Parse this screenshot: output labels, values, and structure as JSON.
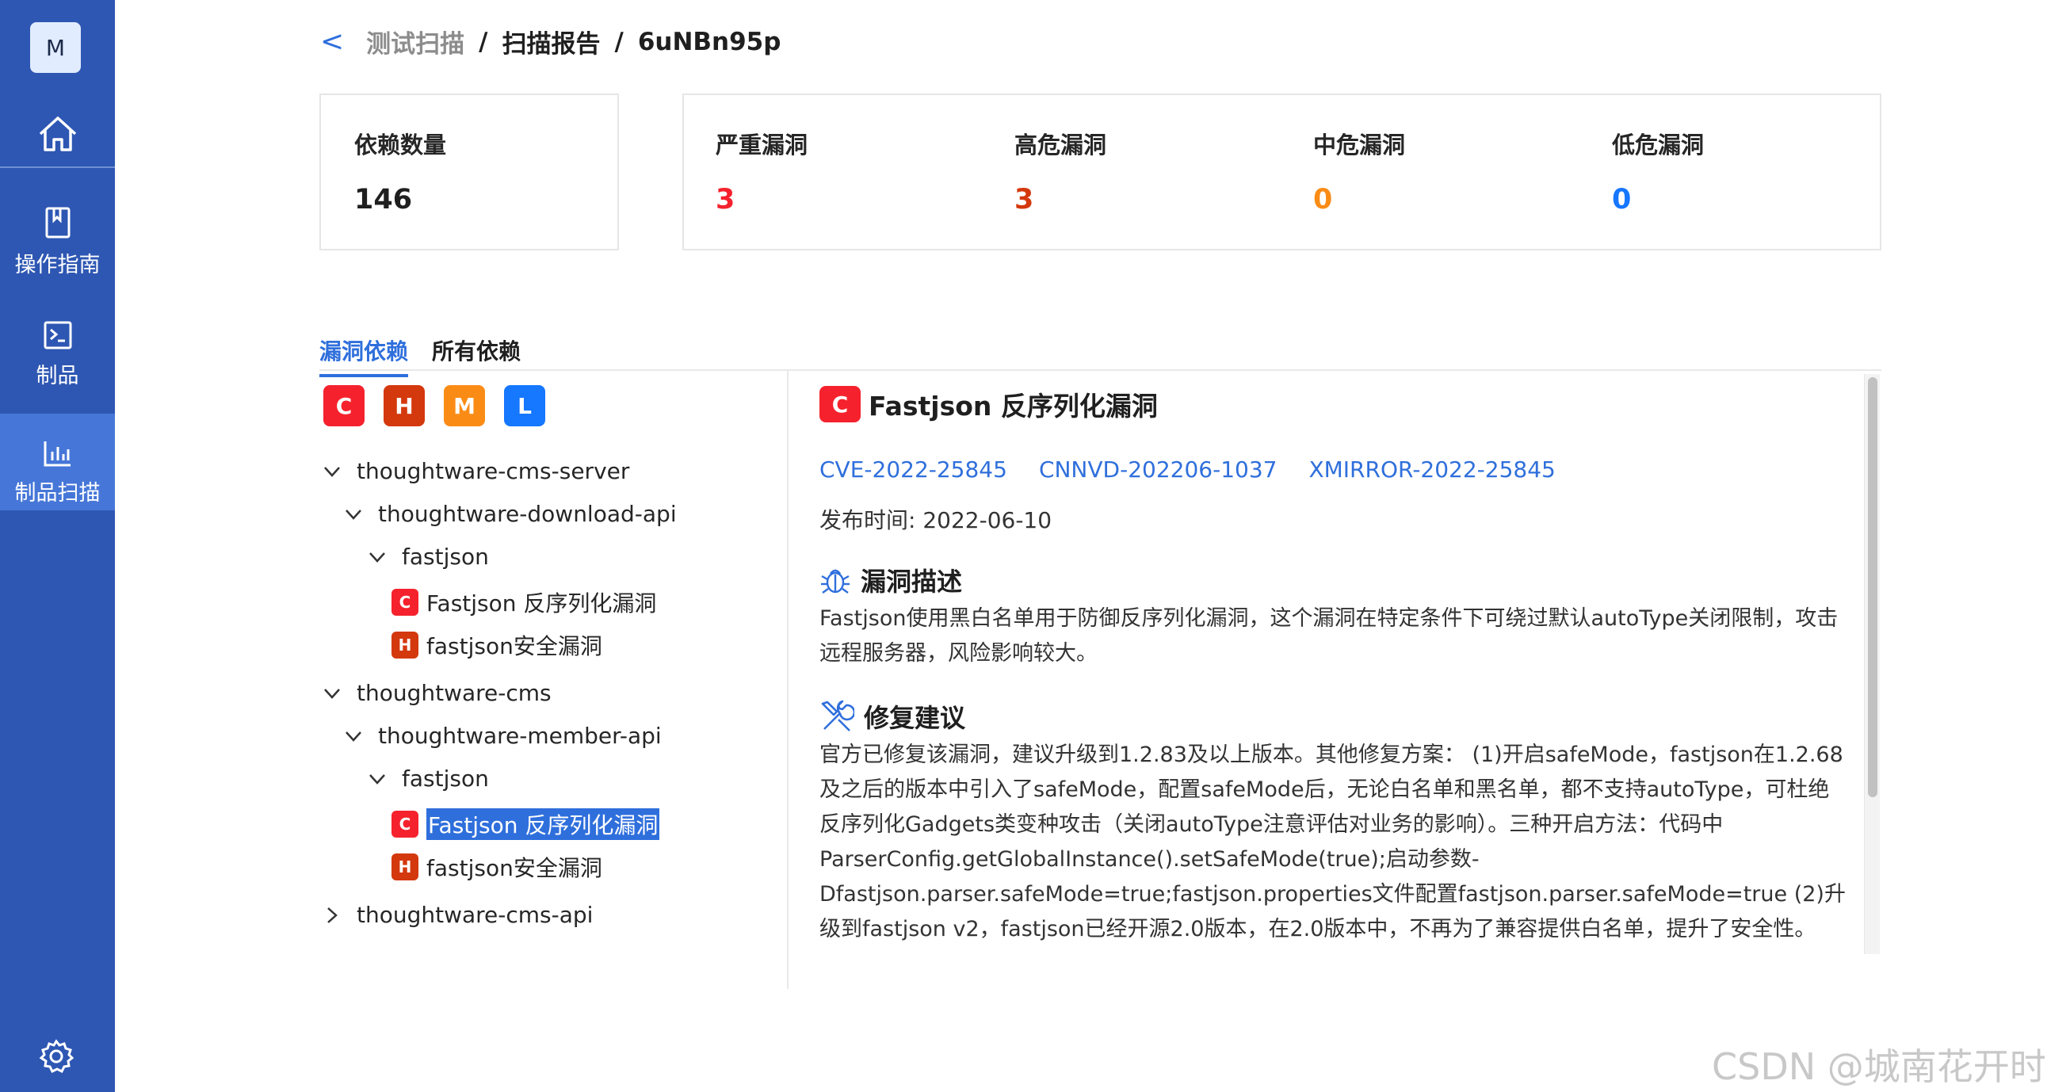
{
  "sidebar": {
    "avatar_letter": "M",
    "items": [
      {
        "label": "操作指南",
        "icon": "book-icon"
      },
      {
        "label": "制品",
        "icon": "terminal-icon"
      },
      {
        "label": "制品扫描",
        "icon": "chart-icon",
        "active": true
      }
    ]
  },
  "breadcrumb": {
    "back_label": "<",
    "parts": [
      "测试扫描",
      "/",
      "扫描报告",
      "/",
      "6uNBn95p"
    ]
  },
  "stats": {
    "dependencies": {
      "label": "依赖数量",
      "value": "146"
    },
    "critical": {
      "label": "严重漏洞",
      "value": "3",
      "color": "#f5222d"
    },
    "high": {
      "label": "高危漏洞",
      "value": "3",
      "color": "#d4380d"
    },
    "medium": {
      "label": "中危漏洞",
      "value": "0",
      "color": "#fa8c16"
    },
    "low": {
      "label": "低危漏洞",
      "value": "0",
      "color": "#1677ff"
    }
  },
  "tabs": [
    {
      "label": "漏洞依赖",
      "active": true
    },
    {
      "label": "所有依赖",
      "active": false
    }
  ],
  "severity_filters": [
    "C",
    "H",
    "M",
    "L"
  ],
  "severity_colors": {
    "C": "#f5222d",
    "H": "#d4380d",
    "M": "#fa8c16",
    "L": "#1677ff"
  },
  "tree": [
    {
      "label": "thoughtware-cms-server"
    },
    {
      "label": "thoughtware-download-api"
    },
    {
      "label": "fastjson"
    },
    {
      "sev": "C",
      "label": "Fastjson 反序列化漏洞"
    },
    {
      "sev": "H",
      "label": "fastjson安全漏洞"
    },
    {
      "label": "thoughtware-cms"
    },
    {
      "label": "thoughtware-member-api"
    },
    {
      "label": "fastjson"
    },
    {
      "sev": "C",
      "label": "Fastjson 反序列化漏洞",
      "selected": true
    },
    {
      "sev": "H",
      "label": "fastjson安全漏洞"
    },
    {
      "label": "thoughtware-cms-api"
    }
  ],
  "detail": {
    "severity": "C",
    "title": "Fastjson 反序列化漏洞",
    "ids": [
      "CVE-2022-25845",
      "CNNVD-202206-1037",
      "XMIRROR-2022-25845"
    ],
    "published": "发布时间: 2022-06-10",
    "desc_heading": "漏洞描述",
    "desc_text": "Fastjson使用黑白名单用于防御反序列化漏洞，这个漏洞在特定条件下可绕过默认autoType关闭限制，攻击远程服务器，风险影响较大。",
    "fix_heading": "修复建议",
    "fix_text": "官方已修复该漏洞，建议升级到1.2.83及以上版本。其他修复方案：  (1)开启safeMode，fastjson在1.2.68及之后的版本中引入了safeMode，配置safeMode后，无论白名单和黑名单，都不支持autoType，可杜绝反序列化Gadgets类变种攻击（关闭autoType注意评估对业务的影响）。三种开启方法：代码中ParserConfig.getGlobalInstance().setSafeMode(true);启动参数-Dfastjson.parser.safeMode=true;fastjson.properties文件配置fastjson.parser.safeMode=true (2)升级到fastjson v2，fastjson已经开源2.0版本，在2.0版本中，不再为了兼容提供白名单，提升了安全性。"
  },
  "watermark": "CSDN @城南花开时"
}
